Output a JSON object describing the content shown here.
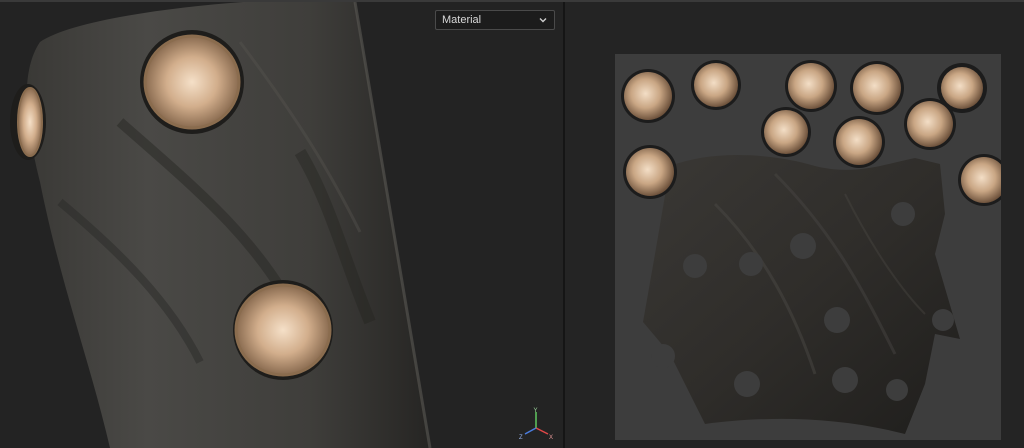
{
  "viewport_3d": {
    "view_mode_dropdown": {
      "value": "Material"
    },
    "axis_gizmo": {
      "x_label": "X",
      "y_label": "Y",
      "z_label": "Z",
      "icon": "axis-gizmo-icon"
    }
  },
  "viewport_2d": {
    "view": "uv-texture-map"
  },
  "colors": {
    "panel_bg": "#232323",
    "uv_canvas_bg": "#3d3d3d",
    "leather": "#2e2c29",
    "metal": "#d6b89a",
    "axis_x": "#e04848",
    "axis_y": "#5fc85f",
    "axis_z": "#4a7de0"
  }
}
